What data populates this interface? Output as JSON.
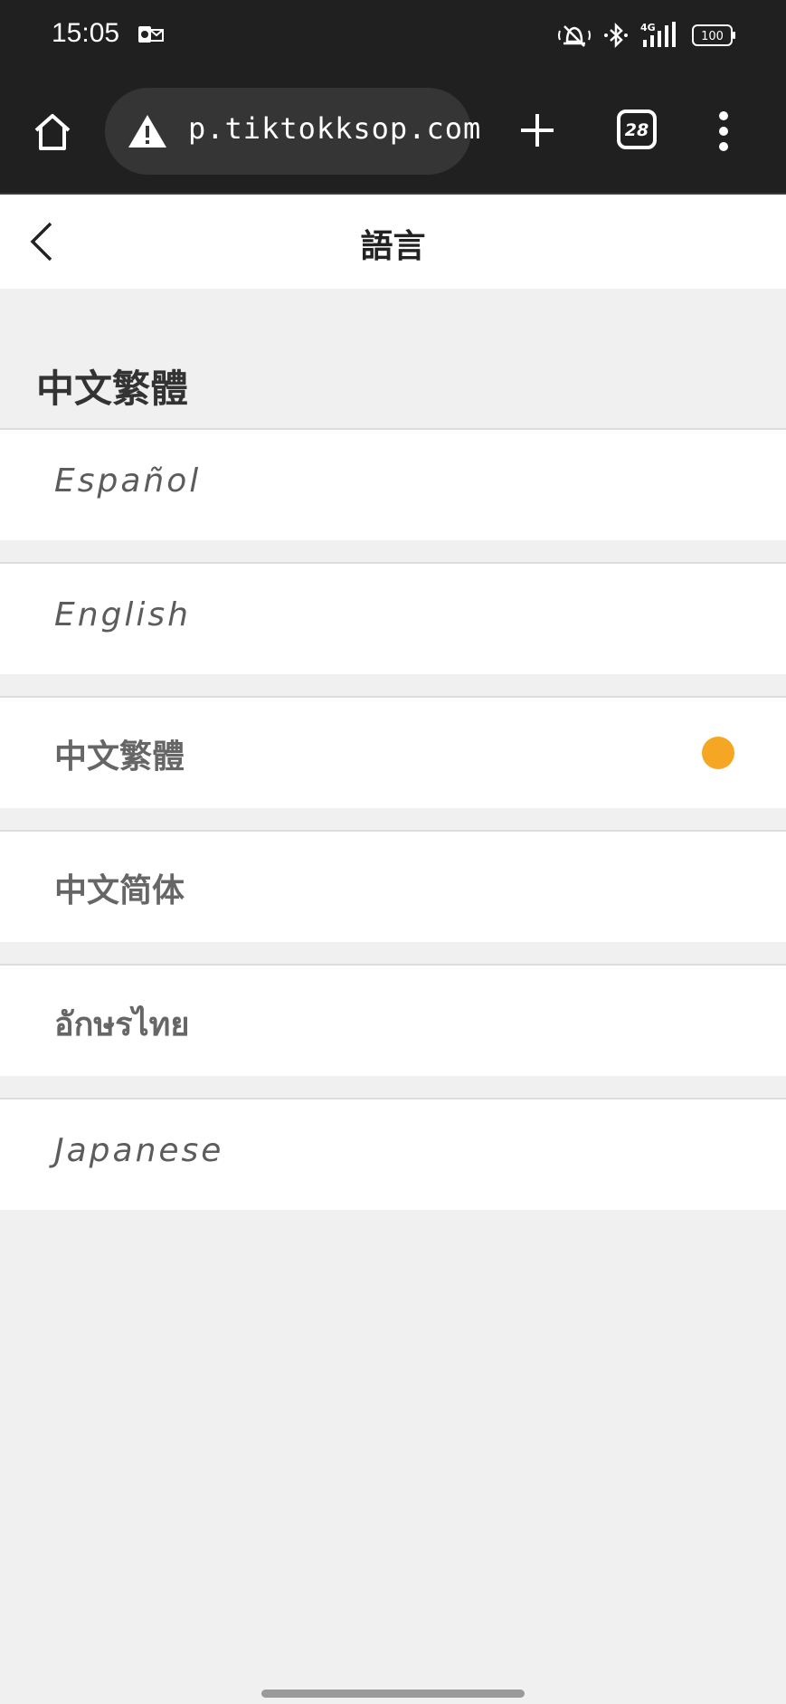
{
  "status_bar": {
    "time": "15:05",
    "notification_icon": "outlook-icon",
    "icons": [
      "silent-bell-icon",
      "bluetooth-icon",
      "signal-4g-icon"
    ],
    "battery": "100"
  },
  "browser": {
    "url": "p.tiktokksop.com",
    "warning_icon": "warning-icon",
    "tab_count": "28"
  },
  "header": {
    "title": "語言",
    "back_icon": "chevron-left-icon"
  },
  "section": {
    "current_language": "中文繁體"
  },
  "languages": [
    {
      "label": "Español",
      "selected": false
    },
    {
      "label": "English",
      "selected": false
    },
    {
      "label": "中文繁體",
      "selected": true
    },
    {
      "label": "中文简体",
      "selected": false
    },
    {
      "label": "อักษรไทย",
      "selected": false
    },
    {
      "label": "Japanese",
      "selected": false
    }
  ],
  "colors": {
    "accent": "#f5a623",
    "browser_bg": "#202020",
    "page_bg": "#f0f0f0"
  }
}
